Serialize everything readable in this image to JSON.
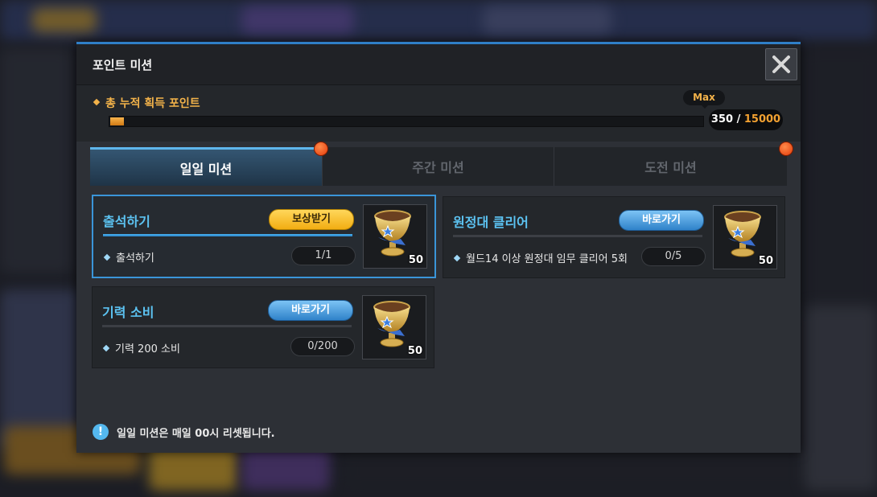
{
  "window": {
    "title": "포인트 미션"
  },
  "points": {
    "label": "총 누적 획득 포인트",
    "current": "350",
    "separator": " / ",
    "max": "15000",
    "max_badge": "Max",
    "progress_fraction": 0.0233
  },
  "tabs": [
    {
      "label": "일일 미션",
      "active": true,
      "has_alert": true
    },
    {
      "label": "주간 미션",
      "active": false,
      "has_alert": false
    },
    {
      "label": "도전 미션",
      "active": false,
      "has_alert": true
    }
  ],
  "missions": [
    {
      "title": "출석하기",
      "button": "보상받기",
      "button_type": "reward",
      "detail": "출석하기",
      "progress": "1/1",
      "reward_amount": "50",
      "reward_icon": "trophy-cup-icon"
    },
    {
      "title": "원정대 클리어",
      "button": "바로가기",
      "button_type": "go",
      "detail": "월드14 이상 원정대 임무 클리어 5회",
      "progress": "0/5",
      "reward_amount": "50",
      "reward_icon": "trophy-cup-icon"
    },
    {
      "title": "기력 소비",
      "button": "바로가기",
      "button_type": "go",
      "detail": "기력 200 소비",
      "progress": "0/200",
      "reward_amount": "50",
      "reward_icon": "trophy-cup-icon"
    }
  ],
  "notice": {
    "icon": "!",
    "text": "일일 미션은 매일 00시 리셋됩니다."
  },
  "colors": {
    "accent": "#5cc3f2",
    "reward_button": "#f2ad12",
    "go_button": "#2f82c9",
    "points_label": "#f2b24a",
    "alert_dot": "#e23b0a"
  }
}
